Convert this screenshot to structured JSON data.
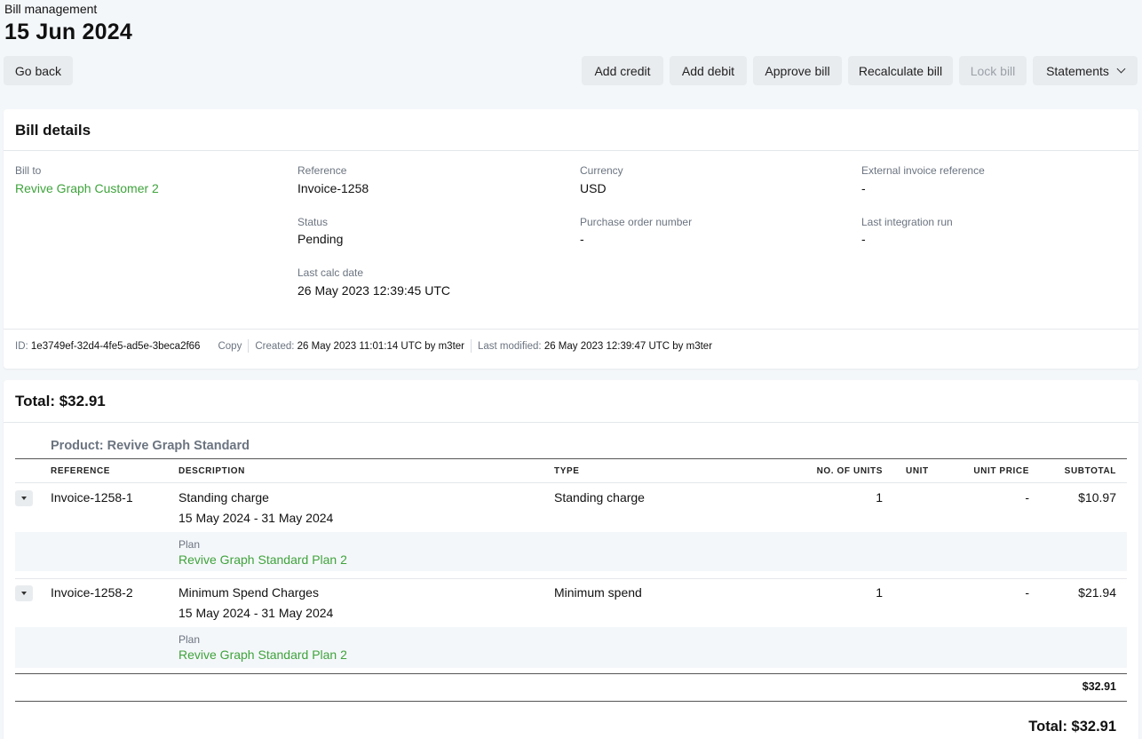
{
  "header": {
    "breadcrumb": "Bill management",
    "title": "15 Jun 2024"
  },
  "toolbar": {
    "go_back": "Go back",
    "add_credit": "Add credit",
    "add_debit": "Add debit",
    "approve_bill": "Approve bill",
    "recalculate_bill": "Recalculate bill",
    "lock_bill": "Lock bill",
    "statements": "Statements"
  },
  "bill_details": {
    "title": "Bill details",
    "bill_to_label": "Bill to",
    "bill_to_value": "Revive Graph Customer 2",
    "reference_label": "Reference",
    "reference_value": "Invoice-1258",
    "currency_label": "Currency",
    "currency_value": "USD",
    "ext_ref_label": "External invoice reference",
    "ext_ref_value": "-",
    "status_label": "Status",
    "status_value": "Pending",
    "po_label": "Purchase order number",
    "po_value": "-",
    "last_int_label": "Last integration run",
    "last_int_value": "-",
    "last_calc_label": "Last calc date",
    "last_calc_value": "26 May 2023 12:39:45 UTC"
  },
  "meta": {
    "id_label": "ID:",
    "id_value": "1e3749ef-32d4-4fe5-ad5e-3beca2f66",
    "copy": "Copy",
    "created_label": "Created:",
    "created_value": "26 May 2023 11:01:14 UTC by m3ter",
    "modified_label": "Last modified:",
    "modified_value": "26 May 2023 12:39:47 UTC by m3ter"
  },
  "totals": {
    "title": "Total: $32.91",
    "product_title": "Product: Revive Graph Standard",
    "columns": {
      "reference": "REFERENCE",
      "description": "DESCRIPTION",
      "type": "TYPE",
      "units": "NO. OF UNITS",
      "unit": "UNIT",
      "unit_price": "UNIT PRICE",
      "subtotal": "SUBTOTAL"
    },
    "rows": [
      {
        "reference": "Invoice-1258-1",
        "description": "Standing charge",
        "period": "15 May 2024 - 31 May 2024",
        "type": "Standing charge",
        "units": "1",
        "unit": "",
        "unit_price": "-",
        "subtotal": "$10.97",
        "plan_label": "Plan",
        "plan_value": "Revive Graph Standard Plan 2"
      },
      {
        "reference": "Invoice-1258-2",
        "description": "Minimum Spend Charges",
        "period": "15 May 2024 - 31 May 2024",
        "type": "Minimum spend",
        "units": "1",
        "unit": "",
        "unit_price": "-",
        "subtotal": "$21.94",
        "plan_label": "Plan",
        "plan_value": "Revive Graph Standard Plan 2"
      }
    ],
    "product_subtotal": "$32.91",
    "grand_total": "Total: $32.91"
  }
}
